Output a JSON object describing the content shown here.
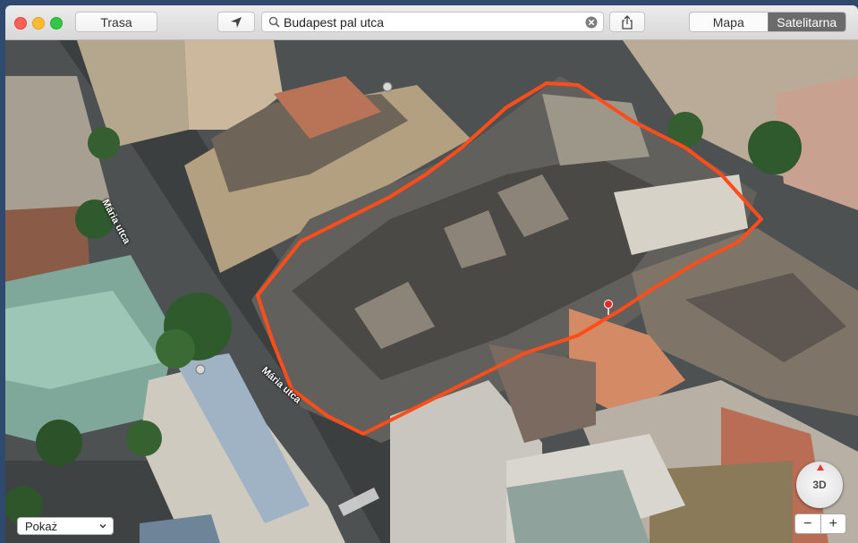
{
  "toolbar": {
    "route_label": "Trasa",
    "search_value": "Budapest pal utca",
    "map_type": {
      "options": [
        "Mapa",
        "Satelitarna"
      ],
      "selected": "Satelitarna"
    }
  },
  "map": {
    "street_labels": [
      "Mária utca",
      "Mária utca"
    ],
    "show_menu_value": "Pokaż",
    "compass_label": "3D",
    "zoom_out": "−",
    "zoom_in": "+"
  },
  "colors": {
    "route_outline": "#ff4d1a",
    "pin": "#e32a2a"
  },
  "icons": {
    "location": "location-arrow-icon",
    "share": "share-icon",
    "search": "search-icon",
    "clear": "clear-icon"
  }
}
